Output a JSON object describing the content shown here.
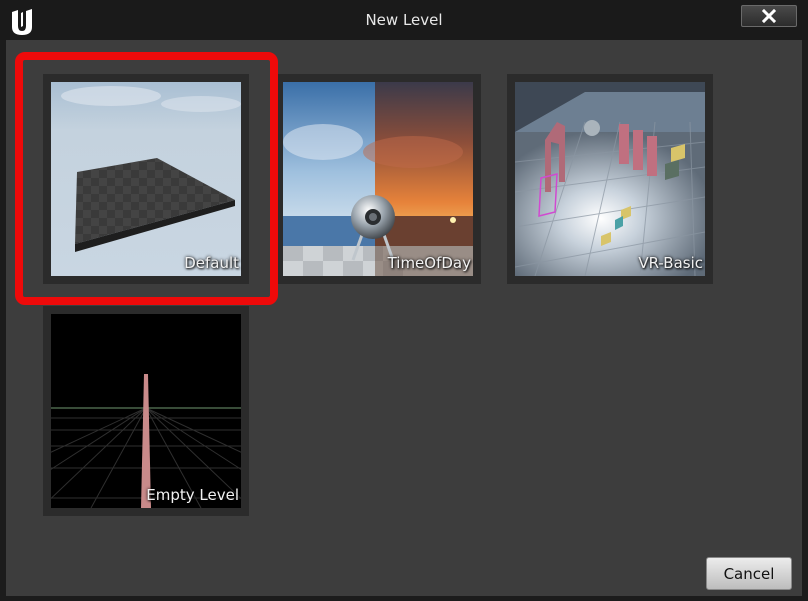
{
  "window": {
    "title": "New Level",
    "close_icon": "close-icon",
    "logo_icon": "unreal-logo-icon"
  },
  "templates": [
    {
      "label": "Default",
      "selected": true
    },
    {
      "label": "TimeOfDay",
      "selected": false
    },
    {
      "label": "VR-Basic",
      "selected": false
    },
    {
      "label": "Empty Level",
      "selected": false
    }
  ],
  "footer": {
    "cancel_label": "Cancel"
  },
  "colors": {
    "selection_highlight": "#ee0a0a",
    "panel_background": "#3d3d3d",
    "tile_background": "#2b2b2b"
  }
}
